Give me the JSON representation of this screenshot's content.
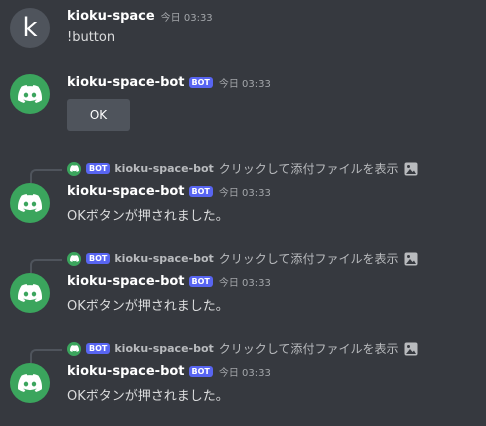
{
  "messages": [
    {
      "username": "kioku-space",
      "avatar_letter": "k",
      "timestamp": "今日 03:33",
      "content": "!button"
    },
    {
      "username": "kioku-space-bot",
      "bot_tag": "BOT",
      "timestamp": "今日 03:33",
      "button_label": "OK"
    },
    {
      "reply": {
        "bot_tag": "BOT",
        "username": "kioku-space-bot",
        "text": "クリックして添付ファイルを表示",
        "icon": "image-icon"
      },
      "username": "kioku-space-bot",
      "bot_tag": "BOT",
      "timestamp": "今日 03:33",
      "content": "OKボタンが押されました。"
    },
    {
      "reply": {
        "bot_tag": "BOT",
        "username": "kioku-space-bot",
        "text": "クリックして添付ファイルを表示",
        "icon": "image-icon"
      },
      "username": "kioku-space-bot",
      "bot_tag": "BOT",
      "timestamp": "今日 03:33",
      "content": "OKボタンが押されました。"
    },
    {
      "reply": {
        "bot_tag": "BOT",
        "username": "kioku-space-bot",
        "text": "クリックして添付ファイルを表示",
        "icon": "image-icon"
      },
      "username": "kioku-space-bot",
      "bot_tag": "BOT",
      "timestamp": "今日 03:33",
      "content": "OKボタンが押されました。"
    }
  ],
  "colors": {
    "background": "#36393f",
    "bot_avatar": "#3ba55d",
    "bot_tag": "#5865f2",
    "button": "#4f545c"
  }
}
